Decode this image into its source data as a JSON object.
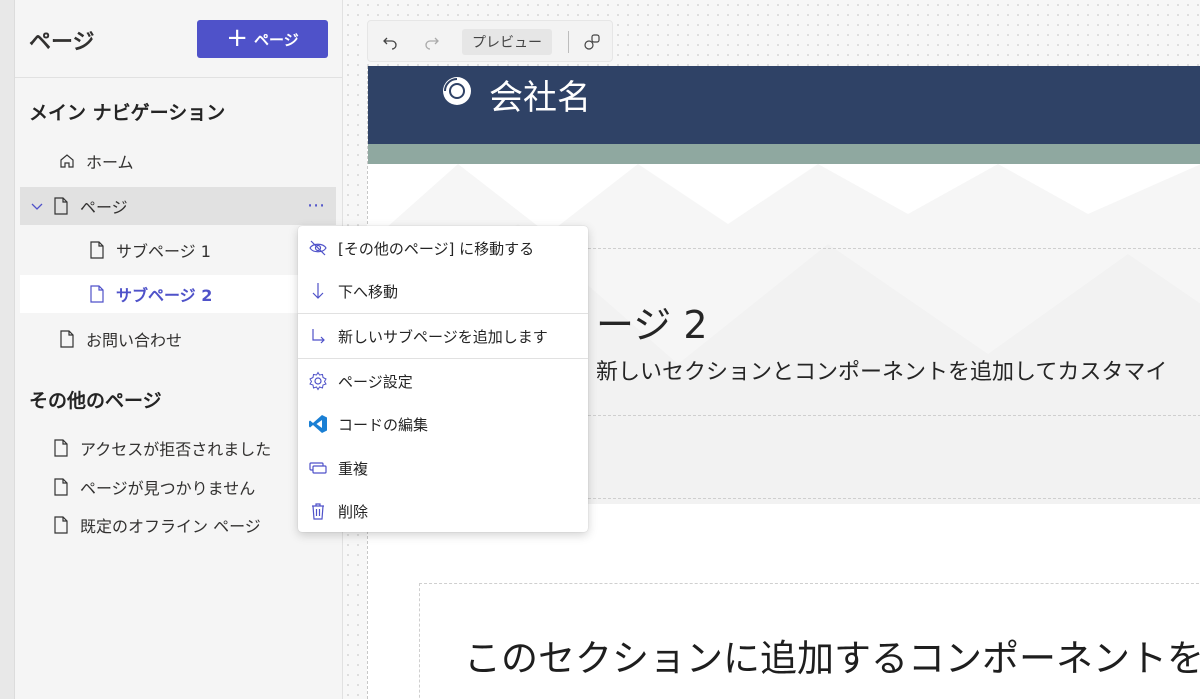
{
  "panel": {
    "title": "ページ",
    "add_button_label": "ページ"
  },
  "main_nav": {
    "heading": "メイン ナビゲーション",
    "items": [
      {
        "label": "ホーム",
        "icon": "home-icon"
      },
      {
        "label": "ページ",
        "icon": "page-icon",
        "expanded": true,
        "selected": true
      },
      {
        "label": "サブページ 1",
        "icon": "page-icon"
      },
      {
        "label": "サブページ 2",
        "icon": "page-icon",
        "active": true
      },
      {
        "label": "お問い合わせ",
        "icon": "page-icon"
      }
    ]
  },
  "other_pages": {
    "heading": "その他のページ",
    "items": [
      {
        "label": "アクセスが拒否されました"
      },
      {
        "label": "ページが見つかりません"
      },
      {
        "label": "既定のオフライン ページ"
      }
    ]
  },
  "toolbar": {
    "preview_label": "プレビュー"
  },
  "context_menu": {
    "items": [
      {
        "label": "[その他のページ] に移動する",
        "icon": "hide-icon"
      },
      {
        "label": "下へ移動",
        "icon": "arrow-down-icon"
      },
      {
        "label": "新しいサブページを追加します",
        "icon": "add-subpage-icon"
      },
      {
        "label": "ページ設定",
        "icon": "gear-icon"
      },
      {
        "label": "コードの編集",
        "icon": "vscode-icon"
      },
      {
        "label": "重複",
        "icon": "duplicate-icon"
      },
      {
        "label": "削除",
        "icon": "trash-icon"
      }
    ]
  },
  "site": {
    "company_name": "会社名",
    "hero_title": "ージ 2",
    "hero_subtitle": "新しいセクションとコンポーネントを追加してカスタマイ",
    "section_text": "このセクションに追加するコンポーネントを"
  },
  "colors": {
    "accent": "#4f52c9",
    "header_bg": "#2f4266",
    "band": "#8fa8a0"
  }
}
